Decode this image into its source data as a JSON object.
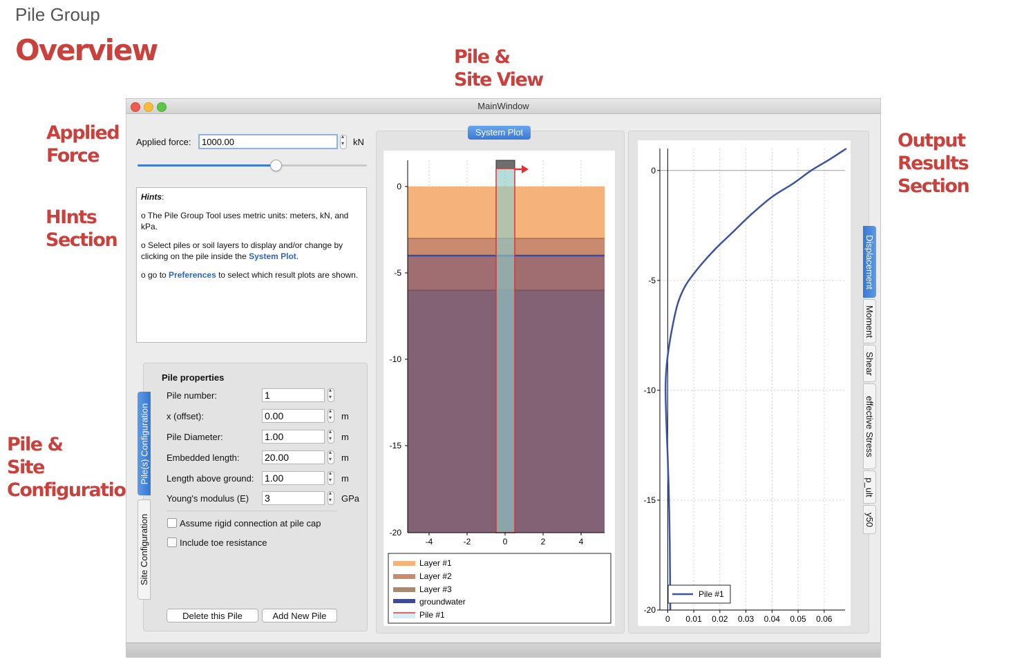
{
  "header": {
    "subtitle": "Pile Group",
    "title": "Overview"
  },
  "annotations": {
    "pile_site_view": "Pile &\nSite  View",
    "applied_force": "Applied\nForce",
    "hints_section": "HInts\nSection",
    "pile_site_config": "Pile &\nSite\nConfiguration",
    "output_results": "Output Results\nSection"
  },
  "window": {
    "title": "MainWindow"
  },
  "force": {
    "label": "Applied force:",
    "value": "1000.00",
    "unit": "kN",
    "slider_fraction": 0.6
  },
  "hints": {
    "heading": "Hints",
    "line1": "o The Pile Group Tool uses metric units: meters, kN, and kPa.",
    "line2_pre": "o Select piles or soil layers to display and/or change by clicking on the pile inside the ",
    "line2_link": "System Plot",
    "line2_post": ".",
    "line3_pre": "o go to ",
    "line3_link": "Preferences",
    "line3_post": " to select which result plots are shown."
  },
  "config_tabs": {
    "piles": "Pile(s) Configuration",
    "site": "Site Configuration"
  },
  "pile_props": {
    "heading": "Pile properties",
    "fields": [
      {
        "label": "Pile number:",
        "value": "1",
        "unit": ""
      },
      {
        "label": "x (offset):",
        "value": "0.00",
        "unit": "m"
      },
      {
        "label": "Pile Diameter:",
        "value": "1.00",
        "unit": "m"
      },
      {
        "label": "Embedded length:",
        "value": "20.00",
        "unit": "m"
      },
      {
        "label": "Length above ground:",
        "value": "1.00",
        "unit": "m"
      },
      {
        "label": "Young's modulus (E)",
        "value": "3",
        "unit": "GPa"
      }
    ],
    "rigid_label": "Assume rigid connection at pile cap",
    "toe_label": "Include toe resistance",
    "delete_btn": "Delete this Pile",
    "add_btn": "Add New Pile"
  },
  "system_plot": {
    "tab_label": "System Plot",
    "x_ticks": [
      "-4",
      "-2",
      "0",
      "2",
      "4"
    ],
    "y_ticks": [
      "0",
      "-5",
      "-10",
      "-15",
      "-20"
    ],
    "legend": [
      "Layer #1",
      "Layer #2",
      "Layer #3",
      "groundwater",
      "Pile #1"
    ],
    "colors": {
      "layer1": "#f5b27a",
      "layer2": "#c98a6f",
      "layer3": "#a06e70",
      "layer4": "#846276",
      "groundwater": "#3b4aa0",
      "pile": "#e03030",
      "pile_fill": "#8ecbc6"
    }
  },
  "chart_data": {
    "type": "line",
    "x_ticks": [
      "0",
      "0.01",
      "0.02",
      "0.03",
      "0.04",
      "0.05",
      "0.06"
    ],
    "y_ticks": [
      "0",
      "-5",
      "-10",
      "-15",
      "-20"
    ],
    "xlim": [
      -0.003,
      0.068
    ],
    "ylim": [
      -20,
      1
    ],
    "series": [
      {
        "name": "Pile #1",
        "color": "#3a52a6",
        "x": [
          0.0685,
          0.062,
          0.055,
          0.048,
          0.04,
          0.032,
          0.025,
          0.018,
          0.012,
          0.007,
          0.004,
          0.002,
          0.0005,
          -0.0005,
          -0.0008,
          -0.0005,
          0.0,
          0.0005,
          0.0008,
          0.001
        ],
        "y": [
          1,
          0.5,
          0,
          -0.6,
          -1.2,
          -2.0,
          -2.8,
          -3.6,
          -4.4,
          -5.2,
          -6.0,
          -7.0,
          -8.0,
          -9.0,
          -10.0,
          -11.5,
          -13.0,
          -15.0,
          -17.0,
          -20
        ]
      }
    ],
    "legend": [
      "Pile #1"
    ],
    "grid": true
  },
  "result_tabs": [
    "Displacement",
    "Moment",
    "Shear",
    "effective Stress",
    "p_ult",
    "y50"
  ]
}
